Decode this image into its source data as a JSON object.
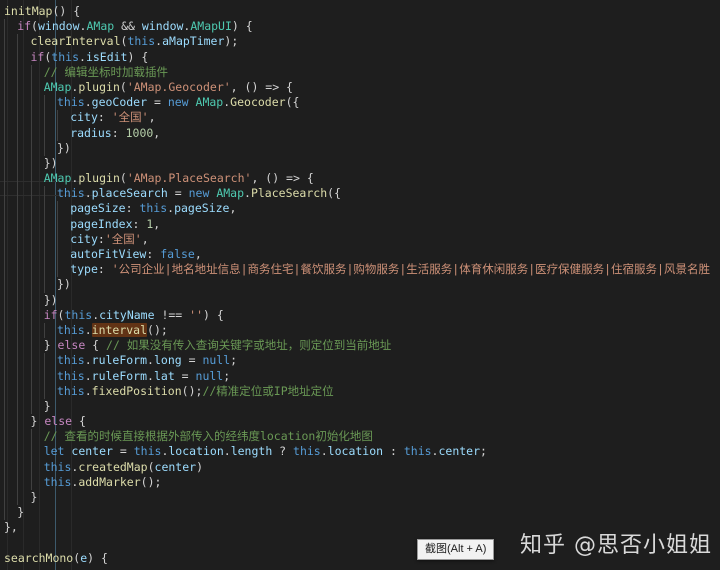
{
  "editor": {
    "theme_name": "dark-plus",
    "background": "#1e1e1e",
    "default_text_color": "#d4d4d4",
    "font_size_px": 11.5,
    "line_height_px": 15.2,
    "colors": {
      "keyword": "#569cd6",
      "control": "#c586c0",
      "function": "#dcdcaa",
      "variable": "#9cdcfe",
      "string": "#ce9178",
      "number": "#b5cea8",
      "comment": "#6a9955",
      "class": "#4ec9b0",
      "punctuation": "#d4d4d4",
      "selection_highlight": "#623315",
      "indent_guide": "#404040",
      "active_indent_guide": "#707070"
    }
  },
  "code": {
    "language": "javascript",
    "lines": [
      "initMap() {",
      "  if(window.AMap && window.AMapUI) {",
      "    clearInterval(this.aMapTimer);",
      "    if(this.isEdit) {",
      "      // 编辑坐标时加载插件",
      "      AMap.plugin('AMap.Geocoder', () => {",
      "        this.geoCoder = new AMap.Geocoder({",
      "          city: '全国',",
      "          radius: 1000,",
      "        })",
      "      })",
      "      AMap.plugin('AMap.PlaceSearch', () => {",
      "        this.placeSearch = new AMap.PlaceSearch({",
      "          pageSize: this.pageSize,",
      "          pageIndex: 1,",
      "          city:'全国',",
      "          autoFitView: false,",
      "          type: '公司企业|地名地址信息|商务住宅|餐饮服务|购物服务|生活服务|体育休闲服务|医疗保健服务|住宿服务|风景名胜",
      "        })",
      "      })",
      "      if(this.cityName !== '') {",
      "        this.interval();",
      "      } else { // 如果没有传入查询关键字或地址，则定位到当前地址",
      "        this.ruleForm.long = null;",
      "        this.ruleForm.lat = null;",
      "        this.fixedPosition();//精准定位或IP地址定位",
      "      }",
      "    } else {",
      "      // 查看的时候直接根据外部传入的经纬度location初始化地图",
      "      let center = this.location.length ? this.location : this.center;",
      "      this.createdMap(center)",
      "      this.addMarker();",
      "    }",
      "  }",
      "},",
      "",
      "searchMono(e) {"
    ],
    "highlighted_word": "interval",
    "matched_brackets": [
      "({",
      "})"
    ]
  },
  "tooltip": {
    "label": "截图(Alt + A)",
    "shortcut": "Alt + A"
  },
  "watermark": {
    "text": "知乎 @思否小姐姐",
    "platform": "知乎",
    "handle": "@思否小姐姐"
  }
}
